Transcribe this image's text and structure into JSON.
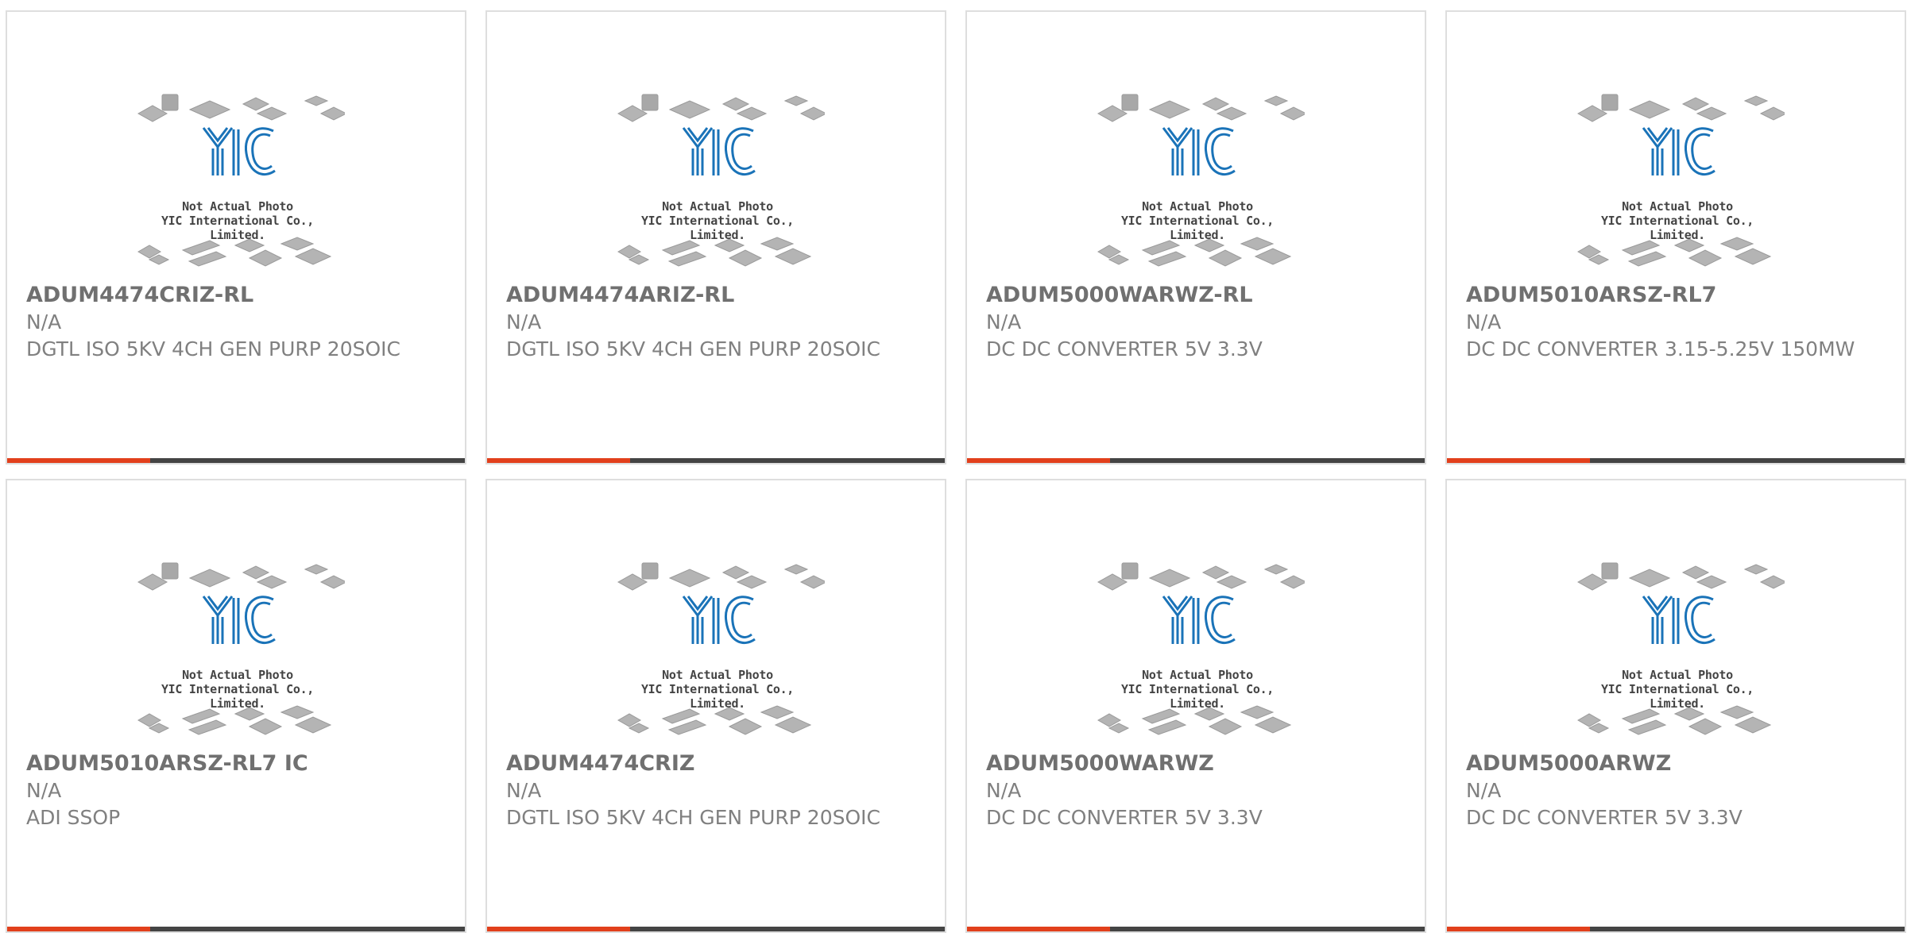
{
  "products": [
    {
      "part": "ADUM4474CRIZ-RL",
      "manufacturer": "N/A",
      "description": "DGTL ISO 5KV 4CH GEN PURP 20SOIC"
    },
    {
      "part": "ADUM4474ARIZ-RL",
      "manufacturer": "N/A",
      "description": "DGTL ISO 5KV 4CH GEN PURP 20SOIC"
    },
    {
      "part": "ADUM5000WARWZ-RL",
      "manufacturer": "N/A",
      "description": "DC DC CONVERTER 5V 3.3V"
    },
    {
      "part": "ADUM5010ARSZ-RL7",
      "manufacturer": "N/A",
      "description": "DC DC CONVERTER 3.15-5.25V 150MW"
    },
    {
      "part": "ADUM5010ARSZ-RL7 IC",
      "manufacturer": "N/A",
      "description": "ADI SSOP"
    },
    {
      "part": "ADUM4474CRIZ",
      "manufacturer": "N/A",
      "description": "DGTL ISO 5KV 4CH GEN PURP 20SOIC"
    },
    {
      "part": "ADUM5000WARWZ",
      "manufacturer": "N/A",
      "description": "DC DC CONVERTER 5V 3.3V"
    },
    {
      "part": "ADUM5000ARWZ",
      "manufacturer": "N/A",
      "description": "DC DC CONVERTER 5V 3.3V"
    }
  ],
  "placeholder": {
    "logo_text": "YIC",
    "line1": "Not Actual Photo",
    "line2": "YIC International Co., Limited."
  },
  "colors": {
    "accent": "#e2401c",
    "bar": "#444444",
    "logo": "#1a73b8"
  }
}
